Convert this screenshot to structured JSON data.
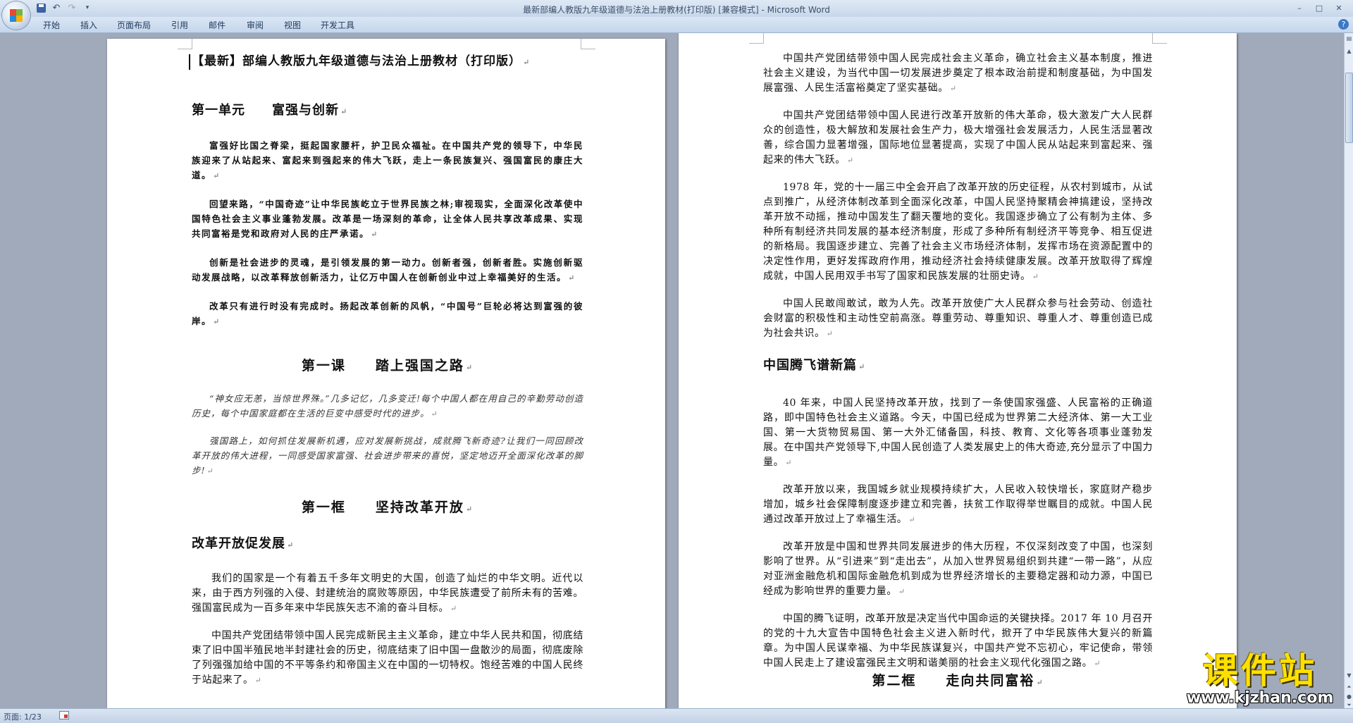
{
  "window": {
    "title": "最新部编人教版九年级道德与法治上册教材(打印版) [兼容模式] - Microsoft Word",
    "minimize": "–",
    "maximize": "□",
    "close": "✕"
  },
  "quick_access": {
    "undo": "↶",
    "redo": "↷",
    "more": "▾"
  },
  "tabs": [
    "开始",
    "插入",
    "页面布局",
    "引用",
    "邮件",
    "审阅",
    "视图",
    "开发工具"
  ],
  "help": "?",
  "page1": {
    "doc_title": "【最新】部编人教版九年级道德与法治上册教材（打印版）",
    "unit_title": "第一单元　　富强与创新",
    "intro_paragraphs": [
      "富强好比国之脊梁，挺起国家腰杆，护卫民众福祉。在中国共产党的领导下，中华民族迎来了从站起来、富起来到强起来的伟大飞跃，走上一条民族复兴、强国富民的康庄大道。",
      "回望来路，“中国奇迹”让中华民族屹立于世界民族之林;审视现实，全面深化改革使中国特色社会主义事业蓬勃发展。改革是一场深刻的革命，让全体人民共享改革成果、实现共同富裕是党和政府对人民的庄严承诺。",
      "创新是社会进步的灵魂，是引领发展的第一动力。创新者强，创新者胜。实施创新驱动发展战略，以改革释放创新活力，让亿万中国人在创新创业中过上幸福美好的生活。",
      "改革只有进行时没有完成时。扬起改革创新的风帆，“中国号”巨轮必将达到富强的彼岸。"
    ],
    "lesson_title": "第一课　　踏上强国之路",
    "quote_paragraphs": [
      "“神女应无恙，当惊世界殊。”几多记忆，几多变迁!每个中国人都在用自己的辛勤劳动创造历史，每个中国家庭都在生活的巨变中感受时代的进步。",
      "强国路上，如何抓住发展新机遇，应对发展新挑战，成就腾飞新奇迹?让我们一同回顾改革开放的伟大进程，一同感受国家富强、社会进步带来的喜悦，坚定地迈开全面深化改革的脚步!"
    ],
    "frame_title": "第一框　　坚持改革开放",
    "section_title": "改革开放促发展",
    "body_paragraphs": [
      "我们的国家是一个有着五千多年文明史的大国，创造了灿烂的中华文明。近代以来，由于西方列强的入侵、封建统治的腐败等原因，中华民族遭受了前所未有的苦难。强国富民成为一百多年来中华民族矢志不渝的奋斗目标。",
      "中国共产党团结带领中国人民完成新民主主义革命，建立中华人民共和国，彻底结束了旧中国半殖民地半封建社会的历史，彻底结束了旧中国一盘散沙的局面，彻底废除了列强强加给中国的不平等条约和帝国主义在中国的一切特权。饱经苦难的中国人民终于站起来了。"
    ]
  },
  "page2": {
    "paragraphs_a": [
      "中国共产党团结带领中国人民完成社会主义革命，确立社会主义基本制度，推进社会主义建设，为当代中国一切发展进步奠定了根本政治前提和制度基础，为中国发展富强、人民生活富裕奠定了坚实基础。",
      "中国共产党团结带领中国人民进行改革开放新的伟大革命，极大激发广大人民群众的创造性，极大解放和发展社会生产力，极大增强社会发展活力，人民生活显著改善，综合国力显著增强，国际地位显著提高，实现了中国人民从站起来到富起来、强起来的伟大飞跃。",
      "1978 年，党的十一届三中全会开启了改革开放的历史征程，从农村到城市，从试点到推广，从经济体制改革到全面深化改革，中国人民坚持聚精会神搞建设，坚持改革开放不动摇，推动中国发生了翻天覆地的变化。我国逐步确立了公有制为主体、多种所有制经济共同发展的基本经济制度，形成了多种所有制经济平等竞争、相互促进的新格局。我国逐步建立、完善了社会主义市场经济体制，发挥市场在资源配置中的决定性作用，更好发挥政府作用，推动经济社会持续健康发展。改革开放取得了辉煌成就，中国人民用双手书写了国家和民族发展的壮丽史诗。",
      "中国人民敢闯敢试，敢为人先。改革开放使广大人民群众参与社会劳动、创造社会财富的积极性和主动性空前高涨。尊重劳动、尊重知识、尊重人才、尊重创造已成为社会共识。"
    ],
    "section_title": "中国腾飞谱新篇",
    "paragraphs_b": [
      "40 年来，中国人民坚持改革开放，找到了一条使国家强盛、人民富裕的正确道路，即中国特色社会主义道路。今天，中国已经成为世界第二大经济体、第一大工业国、第一大货物贸易国、第一大外汇储备国，科技、教育、文化等各项事业蓬勃发展。在中国共产党领导下,中国人民创造了人类发展史上的伟大奇迹,充分显示了中国力量。",
      "改革开放以来，我国城乡就业规模持续扩大，人民收入较快增长，家庭财产稳步增加，城乡社会保障制度逐步建立和完善，扶贫工作取得举世瞩目的成就。中国人民通过改革开放过上了幸福生活。",
      "改革开放是中国和世界共同发展进步的伟大历程，不仅深刻改变了中国，也深刻影响了世界。从“引进来”到“走出去”，从加入世界贸易组织到共建“一带一路”，从应对亚洲金融危机和国际金融危机到成为世界经济增长的主要稳定器和动力源，中国已经成为影响世界的重要力量。",
      "中国的腾飞证明，改革开放是决定当代中国命运的关键抉择。2017 年 10 月召开的党的十九大宣告中国特色社会主义进入新时代，掀开了中华民族伟大复兴的新篇章。为中国人民谋幸福、为中华民族谋复兴，中国共产党不忘初心，牢记使命，带领中国人民走上了建设富强民主文明和谐美丽的社会主义现代化强国之路。"
    ],
    "frame_title": "第二框　　走向共同富裕"
  },
  "statusbar": {
    "page_info": "页面: 1/23"
  },
  "watermark": {
    "big": "课件站",
    "url": "www.kjzhan.com"
  }
}
